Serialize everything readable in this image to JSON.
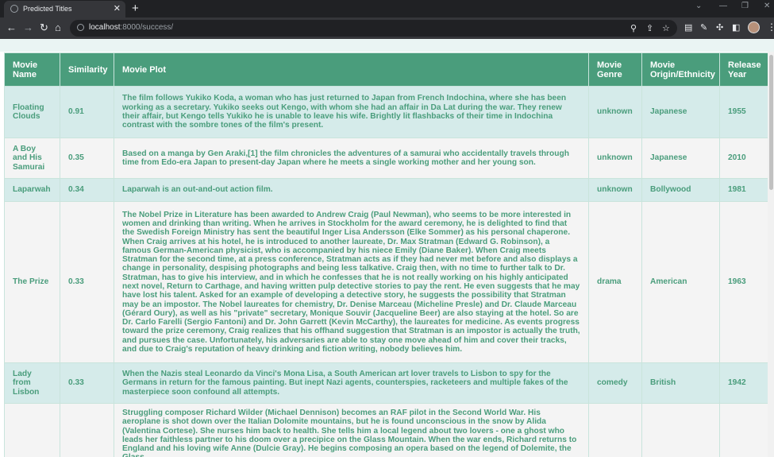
{
  "browser": {
    "tab_title": "Predicted Titles",
    "url_host": "localhost",
    "url_path": ":8000/success/"
  },
  "table": {
    "headers": {
      "name": "Movie Name",
      "similarity": "Similarity",
      "plot": "Movie Plot",
      "genre": "Movie Genre",
      "origin": "Movie Origin/Ethnicity",
      "year": "Release Year"
    },
    "rows": [
      {
        "name": "Floating Clouds",
        "similarity": "0.91",
        "plot": "The film follows Yukiko Koda, a woman who has just returned to Japan from French Indochina, where she has been working as a secretary. Yukiko seeks out Kengo, with whom she had an affair in Da Lat during the war. They renew their affair, but Kengo tells Yukiko he is unable to leave his wife. Brightly lit flashbacks of their time in Indochina contrast with the sombre tones of the film's present.",
        "genre": "unknown",
        "origin": "Japanese",
        "year": "1955"
      },
      {
        "name": "A Boy and His Samurai",
        "similarity": "0.35",
        "plot": "Based on a manga by Gen Araki,[1] the film chronicles the adventures of a samurai who accidentally travels through time from Edo-era Japan to present-day Japan where he meets a single working mother and her young son.",
        "genre": "unknown",
        "origin": "Japanese",
        "year": "2010"
      },
      {
        "name": "Laparwah",
        "similarity": "0.34",
        "plot": "Laparwah is an out-and-out action film.",
        "genre": "unknown",
        "origin": "Bollywood",
        "year": "1981"
      },
      {
        "name": "The Prize",
        "similarity": "0.33",
        "plot": "The Nobel Prize in Literature has been awarded to Andrew Craig (Paul Newman), who seems to be more interested in women and drinking than writing. When he arrives in Stockholm for the award ceremony, he is delighted to find that the Swedish Foreign Ministry has sent the beautiful Inger Lisa Andersson (Elke Sommer) as his personal chaperone. When Craig arrives at his hotel, he is introduced to another laureate, Dr. Max Stratman (Edward G. Robinson), a famous German-American physicist, who is accompanied by his niece Emily (Diane Baker). When Craig meets Stratman for the second time, at a press conference, Stratman acts as if they had never met before and also displays a change in personality, despising photographs and being less talkative. Craig then, with no time to further talk to Dr. Stratman, has to give his interview, and in which he confesses that he is not really working on his highly anticipated next novel, Return to Carthage, and having written pulp detective stories to pay the rent. He even suggests that he may have lost his talent. Asked for an example of developing a detective story, he suggests the possibility that Stratman may be an impostor. The Nobel laureates for chemistry, Dr. Denise Marceau (Micheline Presle) and Dr. Claude Marceau (Gérard Oury), as well as his \"private\" secretary, Monique Souvir (Jacqueline Beer) are also staying at the hotel. So are Dr. Carlo Farelli (Sergio Fantoni) and Dr. John Garrett (Kevin McCarthy), the laureates for medicine. As events progress toward the prize ceremony, Craig realizes that his offhand suggestion that Stratman is an impostor is actually the truth, and pursues the case. Unfortunately, his adversaries are able to stay one move ahead of him and cover their tracks, and due to Craig's reputation of heavy drinking and fiction writing, nobody believes him.",
        "genre": "drama",
        "origin": "American",
        "year": "1963"
      },
      {
        "name": "Lady from Lisbon",
        "similarity": "0.33",
        "plot": "When the Nazis steal Leonardo da Vinci's Mona Lisa, a South American art lover travels to Lisbon to spy for the Germans in return for the famous painting. But inept Nazi agents, counterspies, racketeers and multiple fakes of the masterpiece soon confound all attempts.",
        "genre": "comedy",
        "origin": "British",
        "year": "1942"
      },
      {
        "name": "",
        "similarity": "",
        "plot": "Struggling composer Richard Wilder (Michael Dennison) becomes an RAF pilot in the Second World War. His aeroplane is shot down over the Italian Dolomite mountains, but he is found unconscious in the snow by Alida (Valentina Cortese). She nurses him back to health. She tells him a local legend about two lovers - one a ghost who leads her faithless partner to his doom over a precipice on the Glass Mountain. When the war ends, Richard returns to England and his loving wife Anne (Dulcie Gray). He begins composing an opera based on the legend of Dolemite, the Glass",
        "genre": "",
        "origin": "",
        "year": ""
      }
    ]
  }
}
